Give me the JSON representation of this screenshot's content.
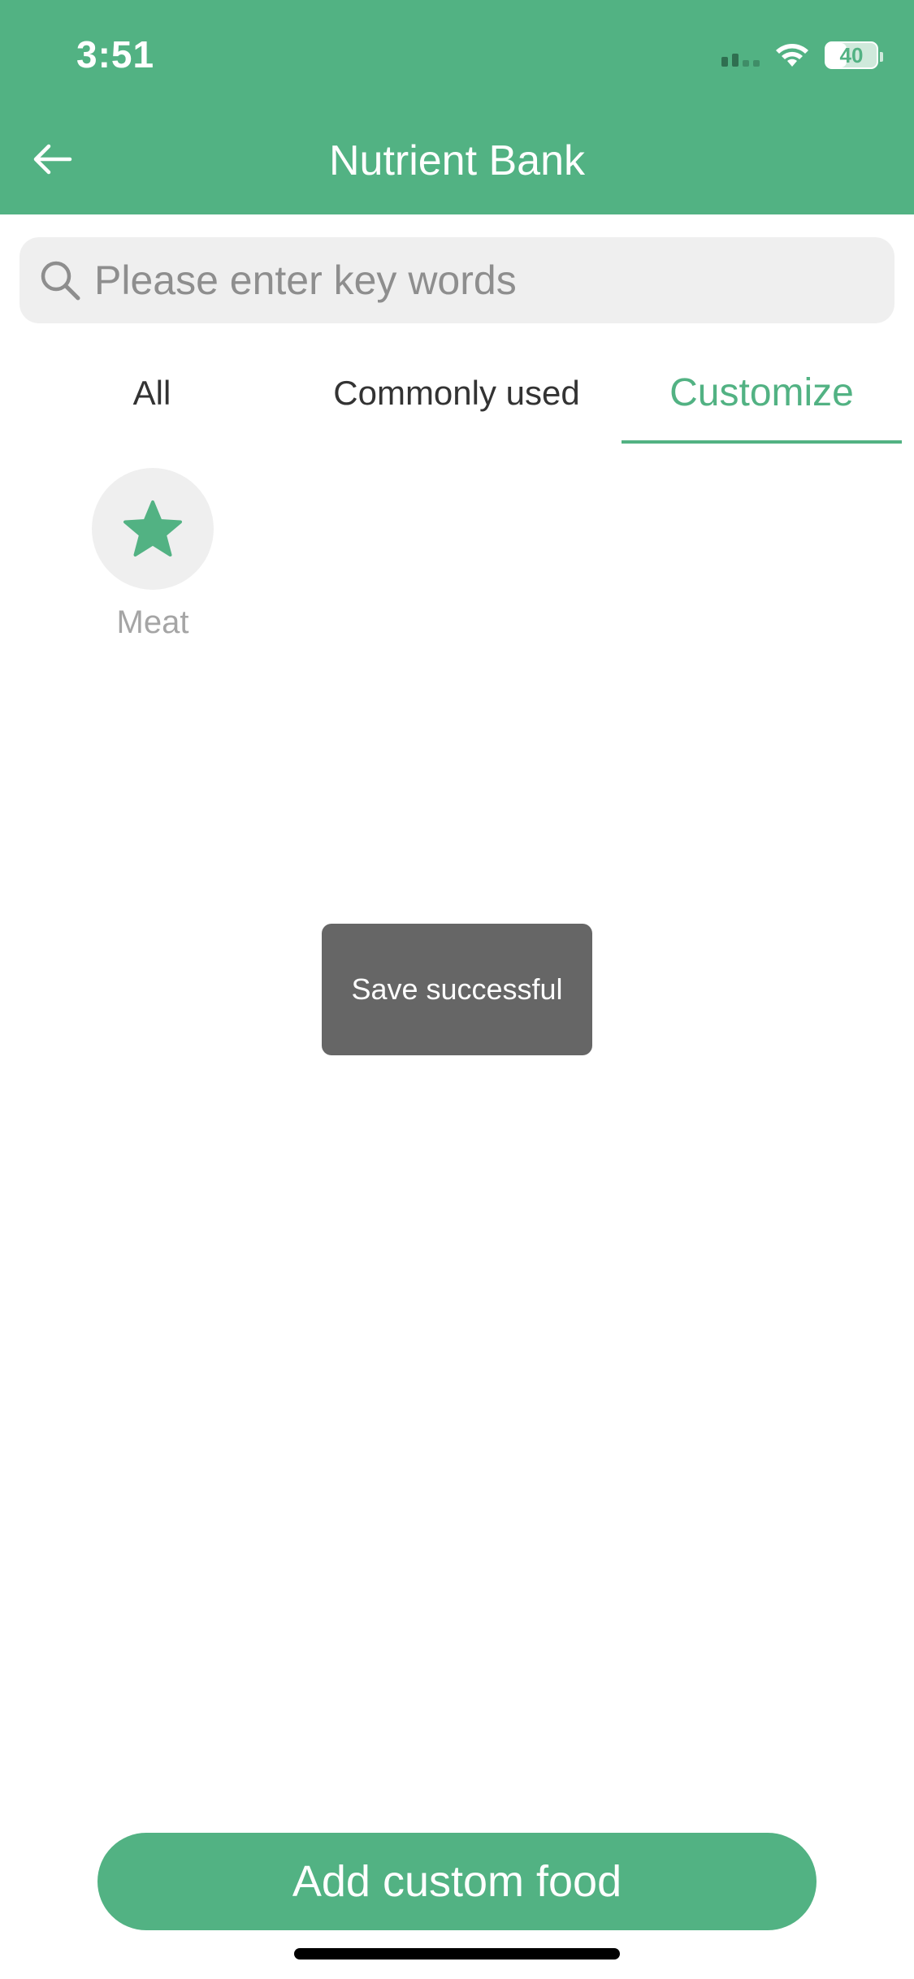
{
  "status_bar": {
    "time": "3:51",
    "battery_level": "40",
    "battery_fraction": 0.4
  },
  "header": {
    "title": "Nutrient Bank",
    "back_icon": "arrow-left-icon"
  },
  "search": {
    "placeholder": "Please enter key words",
    "value": ""
  },
  "tabs": [
    {
      "label": "All",
      "active": false
    },
    {
      "label": "Commonly used",
      "active": false
    },
    {
      "label": "Customize",
      "active": true
    }
  ],
  "categories": [
    {
      "label": "Meat",
      "icon": "star-icon"
    }
  ],
  "toast": {
    "message": "Save successful"
  },
  "footer": {
    "add_button_label": "Add custom food"
  },
  "colors": {
    "accent": "#52B283",
    "toast_bg": "#666666",
    "search_bg": "#EFEFEF"
  }
}
